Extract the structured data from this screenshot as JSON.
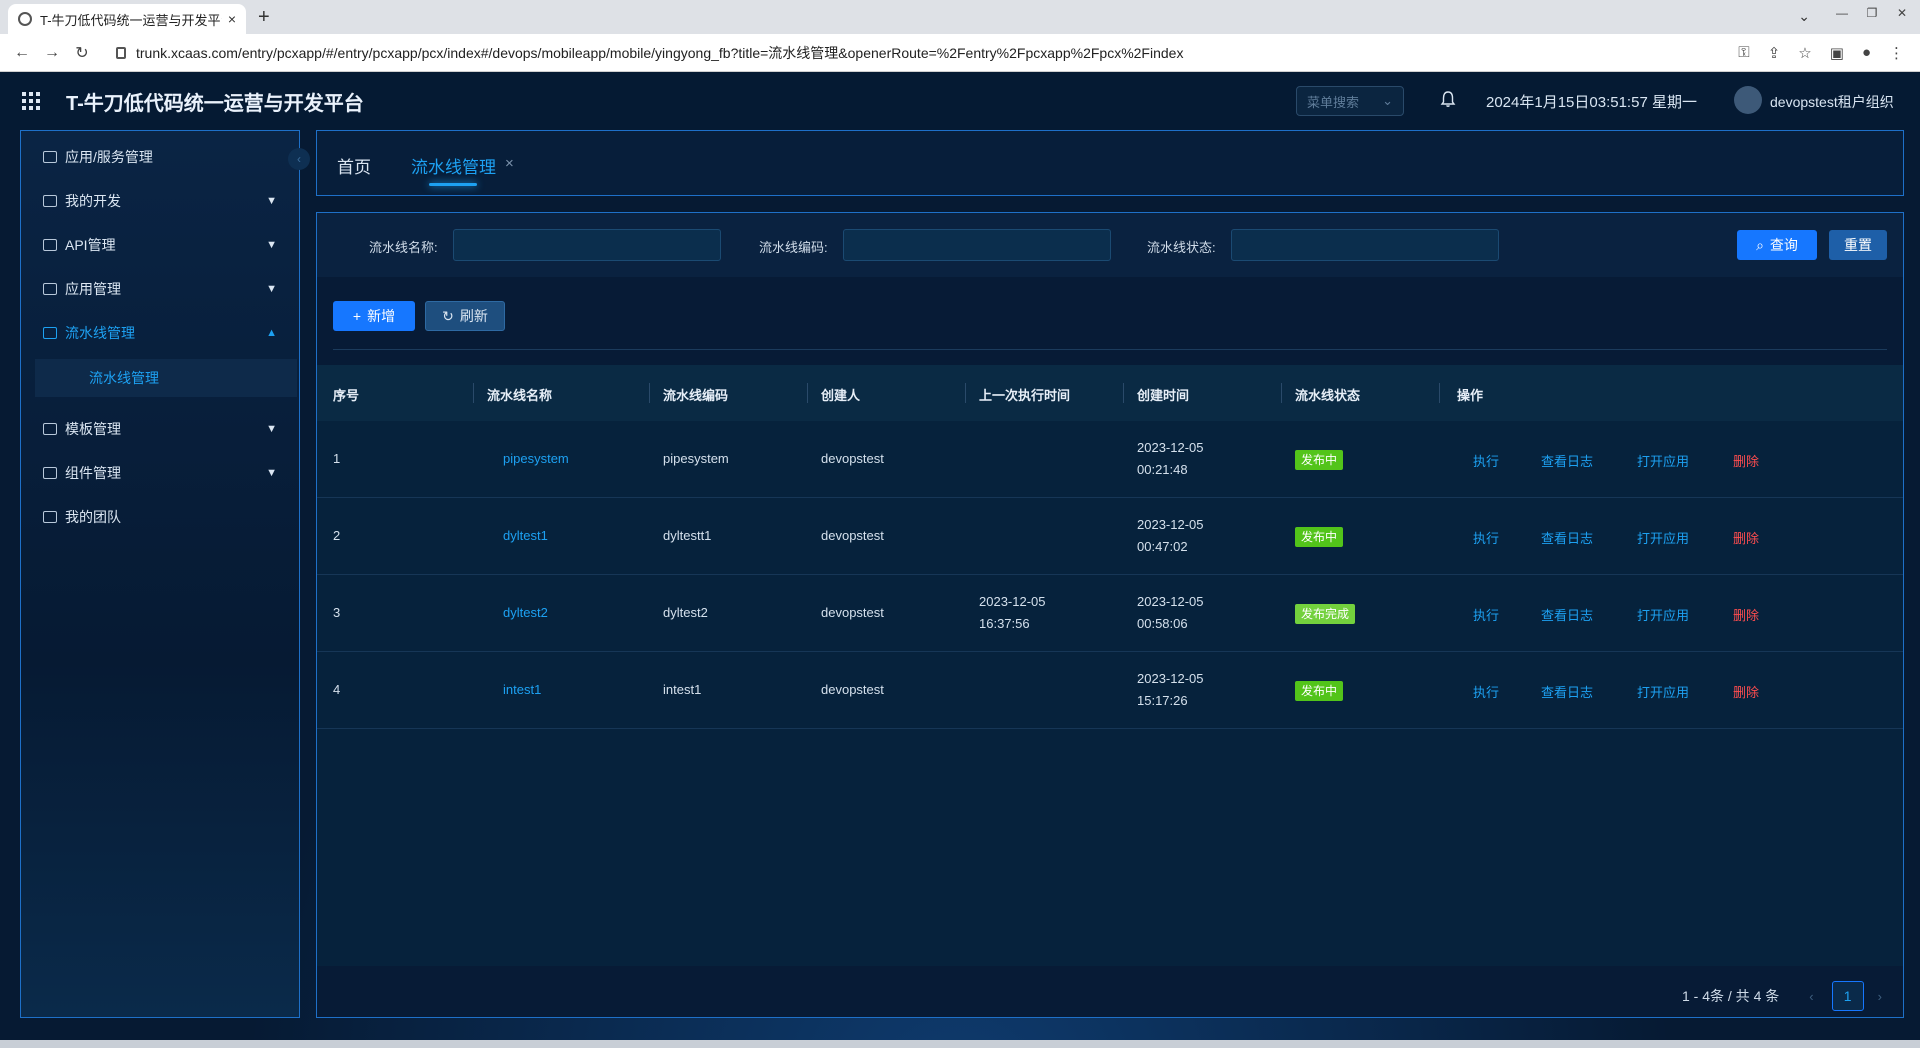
{
  "browser": {
    "tab_title": "T-牛刀低代码统一运营与开发平台",
    "tab_close": "×",
    "new_tab": "+",
    "url": "trunk.xcaas.com/entry/pcxapp/#/entry/pcxapp/pcx/index#/devops/mobileapp/mobile/yingyong_fb?title=流水线管理&openerRoute=%2Fentry%2Fpcxapp%2Fpcx%2Findex"
  },
  "header": {
    "title": "T-牛刀低代码统一运营与开发平台",
    "menu_search_placeholder": "菜单搜索",
    "datetime": "2024年1月15日03:51:57 星期一",
    "user": "devopstest租户组织"
  },
  "sidebar": {
    "items": [
      {
        "label": "应用/服务管理"
      },
      {
        "label": "我的开发"
      },
      {
        "label": "API管理"
      },
      {
        "label": "应用管理"
      },
      {
        "label": "流水线管理"
      },
      {
        "label": "模板管理"
      },
      {
        "label": "组件管理"
      },
      {
        "label": "我的团队"
      }
    ],
    "sub_item": "流水线管理"
  },
  "page_tabs": {
    "home": "首页",
    "active": "流水线管理",
    "close": "×"
  },
  "filters": {
    "name_label": "流水线名称:",
    "code_label": "流水线编码:",
    "status_label": "流水线状态:",
    "query_button": "查询",
    "reset_button": "重置"
  },
  "toolbar": {
    "add_button": "新增",
    "refresh_button": "刷新"
  },
  "table": {
    "columns": [
      "序号",
      "流水线名称",
      "流水线编码",
      "创建人",
      "上一次执行时间",
      "创建时间",
      "流水线状态",
      "操作"
    ],
    "rows": [
      {
        "index": "1",
        "name": "pipesystem",
        "code": "pipesystem",
        "creator": "devopstest",
        "last_run_date": "",
        "last_run_time": "",
        "created_date": "2023-12-05",
        "created_time": "00:21:48",
        "status": "发布中"
      },
      {
        "index": "2",
        "name": "dyltest1",
        "code": "dyltestt1",
        "creator": "devopstest",
        "last_run_date": "",
        "last_run_time": "",
        "created_date": "2023-12-05",
        "created_time": "00:47:02",
        "status": "发布中"
      },
      {
        "index": "3",
        "name": "dyltest2",
        "code": "dyltest2",
        "creator": "devopstest",
        "last_run_date": "2023-12-05",
        "last_run_time": "16:37:56",
        "created_date": "2023-12-05",
        "created_time": "00:58:06",
        "status": "发布完成"
      },
      {
        "index": "4",
        "name": "intest1",
        "code": "intest1",
        "creator": "devopstest",
        "last_run_date": "",
        "last_run_time": "",
        "created_date": "2023-12-05",
        "created_time": "15:17:26",
        "status": "发布中"
      }
    ],
    "actions": {
      "run": "执行",
      "log": "查看日志",
      "open": "打开应用",
      "delete": "删除"
    }
  },
  "pagination": {
    "summary": "1 - 4条 / 共 4 条",
    "current": "1"
  },
  "colors": {
    "accent": "#1da1f2",
    "primary_button": "#1677ff",
    "danger": "#ff4d4f",
    "success_badge": "#52c41a"
  }
}
